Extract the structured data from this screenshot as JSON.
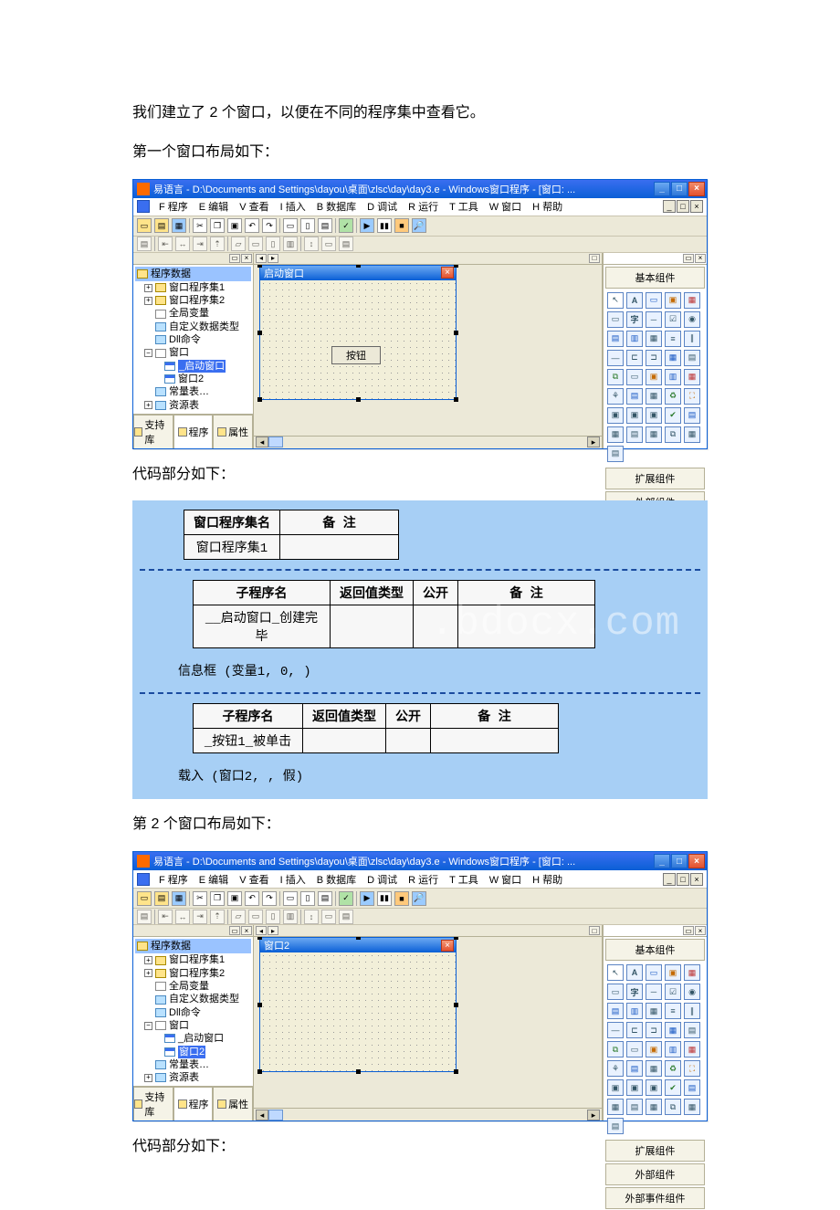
{
  "text": {
    "p1": "我们建立了 2 个窗口，以便在不同的程序集中查看它。",
    "p2": "第一个窗口布局如下：",
    "p3": "代码部分如下：",
    "p4": "第 2 个窗口布局如下：",
    "p5": "代码部分如下："
  },
  "ide": {
    "title": "易语言 - D:\\Documents and Settings\\dayou\\桌面\\zlsc\\day\\day3.e - Windows窗口程序 - [窗口: ...",
    "menus": [
      "F 程序",
      "E 编辑",
      "V 查看",
      "I 插入",
      "B 数据库",
      "D 调试",
      "R 运行",
      "T 工具",
      "W 窗口",
      "H 帮助"
    ],
    "mdi_min": "_",
    "mdi_max": "□",
    "mdi_close": "×",
    "tree_root": "程序数据",
    "tree": {
      "n1": "窗口程序集1",
      "n2": "窗口程序集2",
      "n3": "全局变量",
      "n4": "自定义数据类型",
      "n5": "Dll命令",
      "n6": "窗口",
      "n7": "_启动窗口",
      "n8": "窗口2",
      "n9": "常量表…",
      "n10": "资源表"
    },
    "left_tabs": {
      "a": "支持库",
      "b": "程序",
      "c": "属性"
    },
    "form1_title": "启动窗口",
    "form2_title": "窗口2",
    "button_label": "按钮",
    "palette": {
      "basic": "基本组件",
      "ext": "扩展组件",
      "external": "外部组件",
      "extevt": "外部事件组件"
    },
    "wbtn_min": "_",
    "wbtn_max": "□",
    "wbtn_close": "×"
  },
  "code": {
    "t1_h1": "窗口程序集名",
    "t1_h2": "备  注",
    "t1_r1": "窗口程序集1",
    "t2_h1": "子程序名",
    "t2_h2": "返回值类型",
    "t2_h3": "公开",
    "t2_h4": "备  注",
    "t2_r1": "__启动窗口_创建完毕",
    "line1": "信息框 (变量1, 0, )",
    "t3_h1": "子程序名",
    "t3_h2": "返回值类型",
    "t3_h3": "公开",
    "t3_h4": "备  注",
    "t3_r1": "_按钮1_被单击",
    "line2": "载入 (窗口2, , 假)",
    "watermark": ".bdocx.com"
  }
}
